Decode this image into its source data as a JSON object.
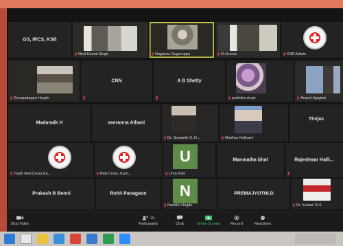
{
  "meeting": {
    "tiles": [
      {
        "name": "GS, IRCS, KSB",
        "style": "name"
      },
      {
        "name": "Neel Kamal Singh",
        "style": "video"
      },
      {
        "name": "Naganna Suguruppa",
        "style": "video"
      },
      {
        "name": "Dr.Kumar",
        "style": "video"
      },
      {
        "name": "KSB Admin",
        "style": "logo"
      },
      {
        "name": "Gurupadappa Hegde",
        "style": "video"
      },
      {
        "name": "CNN",
        "style": "name"
      },
      {
        "name": "A B Shetty",
        "style": "name"
      },
      {
        "name": "prathiba singh",
        "style": "video"
      },
      {
        "name": "Anand Jigajinni",
        "style": "video"
      },
      {
        "name": "Madanaik H",
        "style": "name"
      },
      {
        "name": "veeranna Athani",
        "style": "name"
      },
      {
        "name": "Dr. Sumanth S. H...",
        "style": "video"
      },
      {
        "name": "Madhav Kulkarni",
        "style": "video"
      },
      {
        "name": "Thejas",
        "style": "name"
      },
      {
        "name": "Youth Red Cross Ka...",
        "style": "logo"
      },
      {
        "name": "Red Cross, Karn...",
        "style": "logo"
      },
      {
        "name": "Uma Patil",
        "style": "letter",
        "letter": "U"
      },
      {
        "name": "Manmatha bhat",
        "style": "name"
      },
      {
        "name": "Rajeshwar  Halli...",
        "style": "name"
      },
      {
        "name": "Prakash B Benni",
        "style": "name"
      },
      {
        "name": "Rohit Panagaon",
        "style": "name"
      },
      {
        "name": "Nandini Hegde",
        "style": "letter",
        "letter": "N"
      },
      {
        "name": "PREMAJYOTHI.D",
        "style": "name"
      },
      {
        "name": "Dr. Kumar VLS",
        "style": "video"
      }
    ]
  },
  "toolbar": {
    "stop_video": "Stop Video",
    "participants": "Participants",
    "participants_count": "29",
    "chat": "Chat",
    "share_screen": "Share Screen",
    "record": "Record",
    "reactions": "Reactions"
  },
  "colors": {
    "share_green": "#3cc36a",
    "mute_red": "#e04040",
    "letter_tile": "#5f8b49",
    "active_speaker": "#d4d84a"
  },
  "icons": [
    "camera-icon",
    "participants-icon",
    "chat-icon",
    "share-screen-icon",
    "record-icon",
    "reactions-icon",
    "microphone-muted-icon",
    "red-cross-logo-icon",
    "windows-start-icon",
    "search-icon",
    "browser-icon",
    "folder-icon"
  ]
}
